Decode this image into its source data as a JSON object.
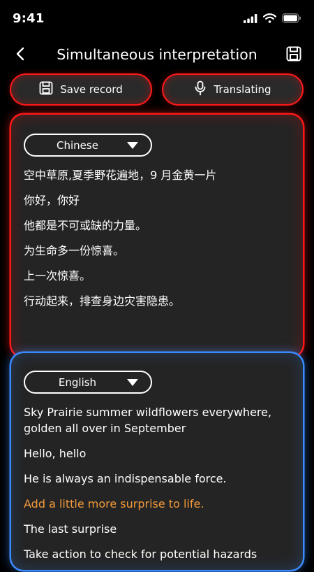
{
  "status_bar": {
    "time": "9:41",
    "icons": [
      "signal-icon",
      "wifi-icon",
      "battery-icon"
    ]
  },
  "nav": {
    "title": "Simultaneous interpretation",
    "icons": {
      "back": "chevron-left-icon",
      "save": "save-icon"
    }
  },
  "actions": {
    "save_label": "Save record",
    "translate_label": "Translating",
    "icons": {
      "save": "floppy-disk-icon",
      "translate": "microphone-icon"
    },
    "accent_color": "#ff1a1a"
  },
  "source_panel": {
    "language": "Chinese",
    "accent_color": "#ff1717",
    "lines": [
      "空中草原,夏季野花遍地，9 月金黄一片",
      "你好，你好",
      "他都是不可或缺的力量。",
      "为生命多一份惊喜。",
      "上一次惊喜。",
      "行动起来，排查身边灾害隐患。"
    ]
  },
  "target_panel": {
    "language": "English",
    "accent_color": "#3a8bff",
    "highlight_color": "#f39a3b",
    "lines": [
      "Sky Prairie summer wildflowers everywhere, golden all over in September",
      "Hello, hello",
      "He is always an indispensable force.",
      "Add a little more surprise to life.",
      "The last surprise",
      "Take action to check for potential hazards"
    ],
    "highlighted_line_index": 3
  }
}
